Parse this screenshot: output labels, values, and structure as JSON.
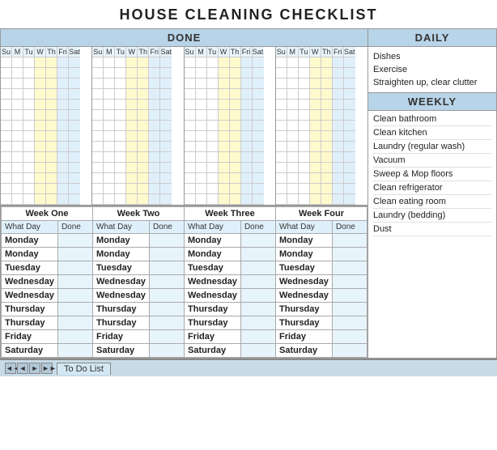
{
  "title": "HOUSE CLEANING CHECKLIST",
  "done_label": "DONE",
  "daily_label": "DAILY",
  "weekly_label": "WEEKLY",
  "day_headers": [
    "Su",
    "M",
    "Tu",
    "W",
    "Th",
    "Fri",
    "Sat"
  ],
  "num_grid_rows": 14,
  "daily_items": [
    "Dishes",
    "Exercise",
    "Straighten up, clear clutter"
  ],
  "weekly_items": [
    "Clean bathroom",
    "Clean kitchen",
    "Laundry (regular wash)",
    "Vacuum",
    "Sweep & Mop floors",
    "Clean refrigerator",
    "Clean eating room",
    "Laundry (bedding)",
    "Dust"
  ],
  "weeks": [
    "Week One",
    "Week Two",
    "Week Three",
    "Week Four"
  ],
  "col_headers": [
    "What Day",
    "Done"
  ],
  "schedule_rows": [
    [
      "Monday",
      "Monday",
      "Monday",
      "Monday"
    ],
    [
      "Monday",
      "Monday",
      "Monday",
      "Monday"
    ],
    [
      "Tuesday",
      "Tuesday",
      "Tuesday",
      "Tuesday"
    ],
    [
      "Wednesday",
      "Wednesday",
      "Wednesday",
      "Wednesday"
    ],
    [
      "Wednesday",
      "Wednesday",
      "Wednesday",
      "Wednesday"
    ],
    [
      "Thursday",
      "Thursday",
      "Thursday",
      "Thursday"
    ],
    [
      "Thursday",
      "Thursday",
      "Thursday",
      "Thursday"
    ],
    [
      "Friday",
      "Friday",
      "Friday",
      "Friday"
    ],
    [
      "Saturday",
      "Saturday",
      "Saturday",
      "Saturday"
    ]
  ],
  "bottom": {
    "nav_arrows": [
      "◄◄",
      "◄",
      "►",
      "►►"
    ],
    "sheet_tab": "To Do List"
  }
}
